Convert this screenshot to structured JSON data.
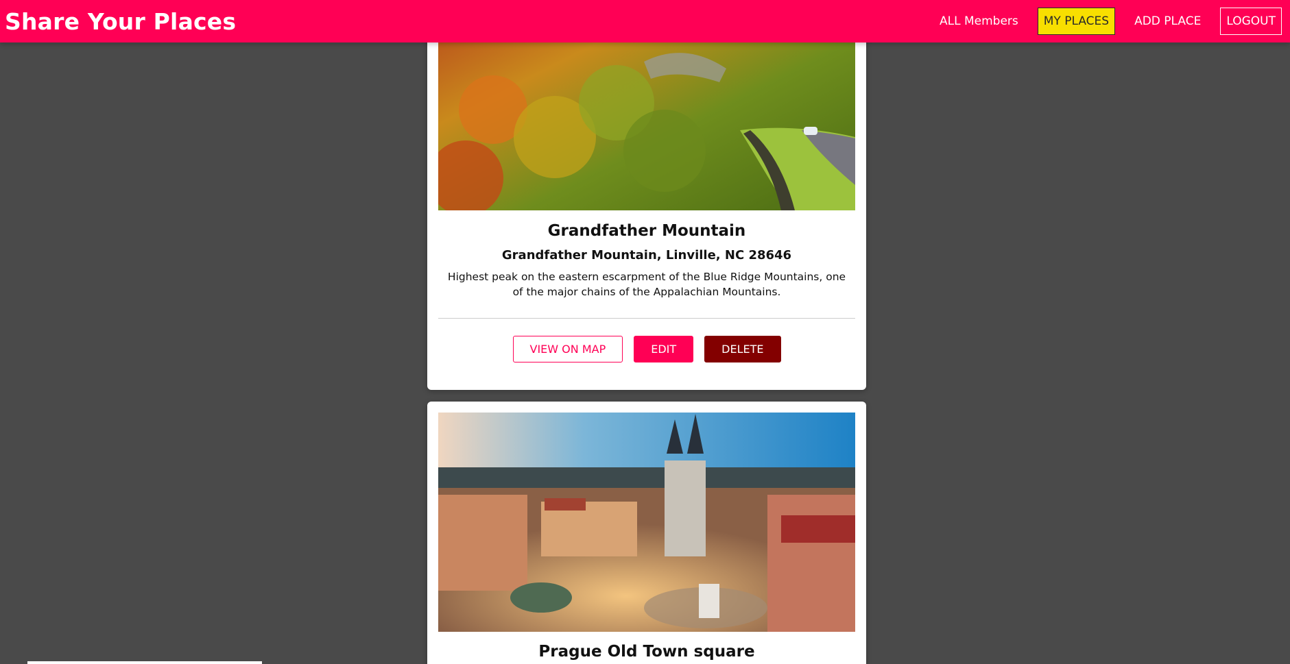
{
  "header": {
    "brand": "Share Your Places",
    "nav": {
      "all_members": "ALL Members",
      "my_places": "MY PLACES",
      "add_place": "ADD PLACE",
      "logout": "LOGOUT"
    },
    "colors": {
      "bar": "#ff0055",
      "active": "#f8df00"
    }
  },
  "places": [
    {
      "title": "Grandfather Mountain",
      "address": "Grandfather Mountain, Linville, NC 28646",
      "description": "Highest peak on the eastern escarpment of the Blue Ridge Mountains, one of the major chains of the Appalachian Mountains.",
      "actions": {
        "view": "VIEW ON MAP",
        "edit": "EDIT",
        "delete": "DELETE"
      }
    },
    {
      "title": "Prague Old Town square"
    }
  ]
}
